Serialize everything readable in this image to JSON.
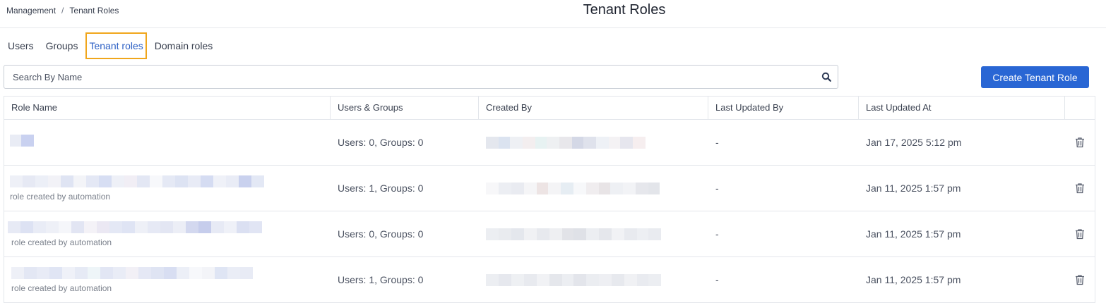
{
  "breadcrumb": {
    "parent": "Management",
    "separator": "/",
    "current": "Tenant Roles"
  },
  "page_title": "Tenant Roles",
  "tabs": [
    {
      "label": "Users",
      "active": false
    },
    {
      "label": "Groups",
      "active": false
    },
    {
      "label": "Tenant roles",
      "active": true
    },
    {
      "label": "Domain roles",
      "active": false
    }
  ],
  "search": {
    "placeholder": "Search By Name",
    "value": "",
    "icon": "search-icon"
  },
  "create_button": {
    "label": "Create Tenant Role"
  },
  "colors": {
    "accent": "#2966d4",
    "active_tab_text": "#2b5fc4",
    "highlight_border": "#f0a61c"
  },
  "table": {
    "columns": [
      "Role Name",
      "Users & Groups",
      "Created By",
      "Last Updated By",
      "Last Updated At",
      ""
    ],
    "rows": [
      {
        "role_name": "",
        "description": "",
        "users_groups": "Users: 0, Groups: 0",
        "created_by": "",
        "last_updated_by": "-",
        "last_updated_at": "Jan 17, 2025 5:12 pm",
        "action_icon": "trash-icon"
      },
      {
        "role_name": "",
        "description": "role created by automation",
        "users_groups": "Users: 1, Groups: 0",
        "created_by": "",
        "last_updated_by": "-",
        "last_updated_at": "Jan 11, 2025 1:57 pm",
        "action_icon": "trash-icon"
      },
      {
        "role_name": "",
        "description": "role created by automation",
        "users_groups": "Users: 0, Groups: 0",
        "created_by": "",
        "last_updated_by": "-",
        "last_updated_at": "Jan 11, 2025 1:57 pm",
        "action_icon": "trash-icon"
      },
      {
        "role_name": "",
        "description": "role created by automation",
        "users_groups": "Users: 1, Groups: 0",
        "created_by": "",
        "last_updated_by": "-",
        "last_updated_at": "Jan 11, 2025 1:57 pm",
        "action_icon": "trash-icon"
      }
    ]
  }
}
